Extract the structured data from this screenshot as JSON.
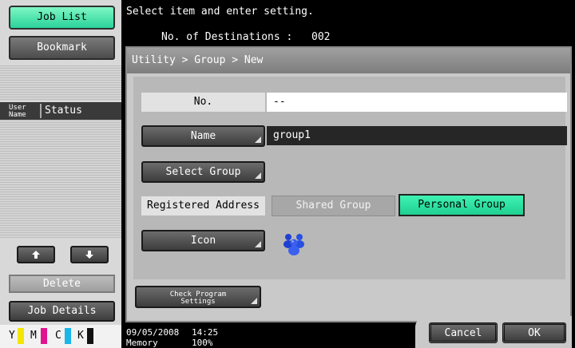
{
  "left": {
    "job_list": "Job List",
    "bookmark": "Bookmark",
    "col_user": "User Name",
    "col_user_line1": "User",
    "col_user_line2": "Name",
    "col_status": "Status",
    "up_icon": "up-arrow-icon",
    "down_icon": "down-arrow-icon",
    "delete": "Delete",
    "job_details": "Job Details",
    "toner": [
      {
        "label": "Y",
        "color": "#f3e600"
      },
      {
        "label": "M",
        "color": "#e0148c"
      },
      {
        "label": "C",
        "color": "#19b6e8"
      },
      {
        "label": "K",
        "color": "#111111"
      }
    ]
  },
  "header": {
    "message": "Select item and enter setting.",
    "destinations_label": "No. of Destinations :",
    "destinations_value": "002"
  },
  "panel": {
    "breadcrumb": "Utility > Group > New",
    "no_label": "No.",
    "no_value": "--",
    "name_label": "Name",
    "name_value": "group1",
    "select_group": "Select Group",
    "registered_address_label": "Registered Address",
    "shared_group": "Shared Group",
    "personal_group": "Personal Group",
    "icon_label": "Icon",
    "icon_name": "group-people-icon",
    "check_program_line1": "Check Program",
    "check_program_line2": "Settings"
  },
  "footer": {
    "date": "09/05/2008",
    "time": "14:25",
    "memory_label": "Memory",
    "memory_value": "100%",
    "cancel": "Cancel",
    "ok": "OK"
  }
}
